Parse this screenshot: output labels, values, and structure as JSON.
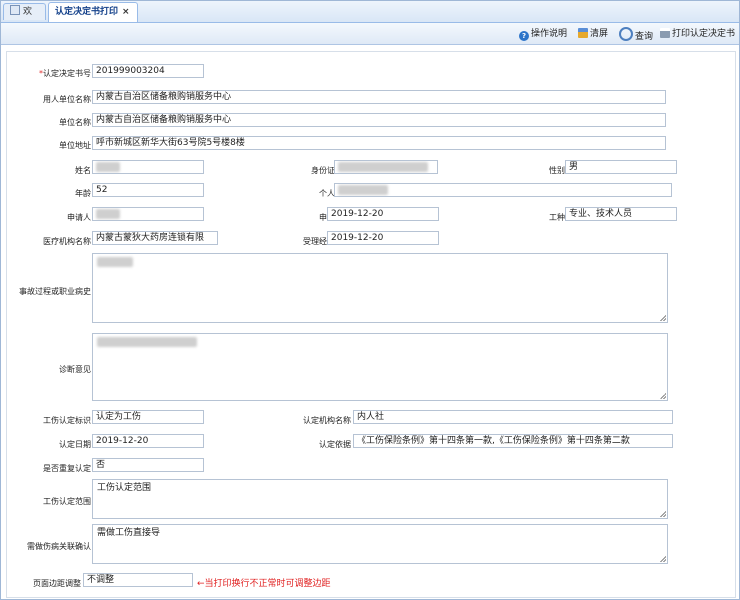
{
  "tabs": [
    {
      "label": "欢迎"
    },
    {
      "label": "认定决定书打印"
    }
  ],
  "toolbar": {
    "help": "操作说明",
    "clear": "清屏",
    "query": "查询",
    "print": "打印认定决定书"
  },
  "form": {
    "decision_no": {
      "label": "认定决定书号",
      "value": "201999003204"
    },
    "employer_name": {
      "label": "用人单位名称",
      "value": "内蒙古自治区储备粮购销服务中心"
    },
    "unit_name": {
      "label": "单位名称",
      "value": "内蒙古自治区储备粮购销服务中心"
    },
    "unit_address": {
      "label": "单位地址",
      "value": "呼市新城区新华大街63号院5号楼8楼"
    },
    "name": {
      "label": "姓名"
    },
    "id_no": {
      "label": "身份证号码"
    },
    "gender": {
      "label": "性别",
      "value": "男"
    },
    "age": {
      "label": "年龄",
      "value": "52"
    },
    "personal_address": {
      "label": "个人地址"
    },
    "applicant": {
      "label": "申请人"
    },
    "apply_date": {
      "label": "申请日期",
      "value": "2019-12-20"
    },
    "job_type": {
      "label": "工种",
      "value": "专业、技术人员"
    },
    "medical_org": {
      "label": "医疗机构名称",
      "value": "内蒙古蒙狄大药房连锁有限"
    },
    "accept_date": {
      "label": "受理经办日期",
      "value": "2019-12-20"
    },
    "accident_process": {
      "label": "事故过程或职业病史"
    },
    "diagnosis": {
      "label": "诊断意见"
    },
    "injury_flag": {
      "label": "工伤认定标识",
      "value": "认定为工伤"
    },
    "org_name": {
      "label": "认定机构名称",
      "value": "内人社"
    },
    "decision_date": {
      "label": "认定日期",
      "value": "2019-12-20"
    },
    "basis": {
      "label": "认定依据",
      "value": "《工伤保险条例》第十四条第一款,《工伤保险条例》第十四条第二款"
    },
    "repeat": {
      "label": "是否重复认定",
      "value": "否"
    },
    "scope": {
      "label": "工伤认定范围",
      "value": "工伤认定范围"
    },
    "related_confirm": {
      "label": "需做伤病关联确认",
      "value": "需做工伤直接导"
    },
    "margin": {
      "label": "页面边距调整",
      "value": "不调整"
    },
    "margin_note": "←当打印换行不正常时可调整边距"
  }
}
